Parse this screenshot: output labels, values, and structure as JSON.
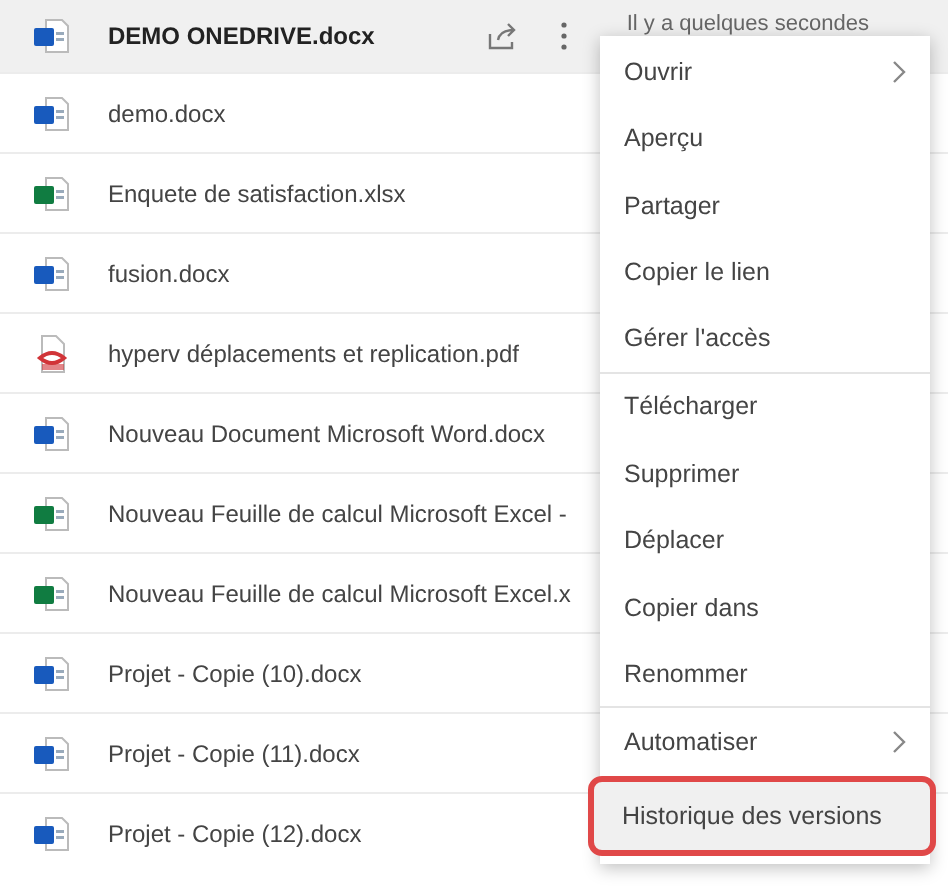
{
  "files": [
    {
      "name": "DEMO ONEDRIVE.docx",
      "kind": "word",
      "selected": true,
      "modified": "Il y a quelques secondes"
    },
    {
      "name": "demo.docx",
      "kind": "word",
      "selected": false
    },
    {
      "name": "Enquete de satisfaction.xlsx",
      "kind": "excel",
      "selected": false
    },
    {
      "name": "fusion.docx",
      "kind": "word",
      "selected": false
    },
    {
      "name": "hyperv déplacements et replication.pdf",
      "kind": "pdf",
      "selected": false
    },
    {
      "name": "Nouveau Document Microsoft Word.docx",
      "kind": "word",
      "selected": false
    },
    {
      "name": "Nouveau Feuille de calcul Microsoft Excel -",
      "kind": "excel",
      "selected": false
    },
    {
      "name": "Nouveau Feuille de calcul Microsoft Excel.x",
      "kind": "excel",
      "selected": false
    },
    {
      "name": "Projet - Copie (10).docx",
      "kind": "word",
      "selected": false
    },
    {
      "name": "Projet - Copie (11).docx",
      "kind": "word",
      "selected": false
    },
    {
      "name": "Projet - Copie (12).docx",
      "kind": "word",
      "selected": false
    }
  ],
  "context_menu": [
    {
      "label": "Ouvrir",
      "submenu": true,
      "divider_after": false,
      "highlighted": false
    },
    {
      "label": "Aperçu",
      "submenu": false,
      "divider_after": false,
      "highlighted": false
    },
    {
      "label": "Partager",
      "submenu": false,
      "divider_after": false,
      "highlighted": false
    },
    {
      "label": "Copier le lien",
      "submenu": false,
      "divider_after": false,
      "highlighted": false
    },
    {
      "label": "Gérer l'accès",
      "submenu": false,
      "divider_after": true,
      "highlighted": false
    },
    {
      "label": "Télécharger",
      "submenu": false,
      "divider_after": false,
      "highlighted": false
    },
    {
      "label": "Supprimer",
      "submenu": false,
      "divider_after": false,
      "highlighted": false
    },
    {
      "label": "Déplacer",
      "submenu": false,
      "divider_after": false,
      "highlighted": false
    },
    {
      "label": "Copier dans",
      "submenu": false,
      "divider_after": false,
      "highlighted": false
    },
    {
      "label": "Renommer",
      "submenu": false,
      "divider_after": true,
      "highlighted": false
    },
    {
      "label": "Automatiser",
      "submenu": true,
      "divider_after": false,
      "highlighted": false
    },
    {
      "label": "Historique des versions",
      "submenu": false,
      "divider_after": false,
      "highlighted": true
    }
  ]
}
